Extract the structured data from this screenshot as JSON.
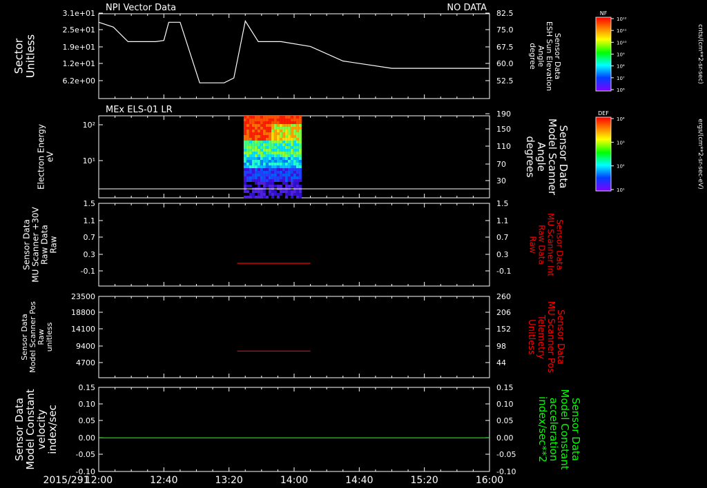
{
  "colors": {
    "background": "#000000",
    "foreground": "#ffffff",
    "red_axis": "#ff0000",
    "green_axis": "#00ff00",
    "spectrogram_hot": "#ff2000",
    "spectrogram_low": "#3010e0"
  },
  "time_axis": {
    "date": "2015/291",
    "ticks": [
      "12:00",
      "12:40",
      "13:20",
      "14:00",
      "14:40",
      "15:20",
      "16:00"
    ],
    "range": [
      "12:00",
      "16:00"
    ]
  },
  "colorbars": [
    {
      "tag": "NF",
      "units": "cnts/(cm**2-sr-sec)",
      "tick_labels": [
        "10¹²",
        "10¹¹",
        "10¹⁰",
        "10⁹",
        "10⁸",
        "10⁷",
        "10⁶"
      ]
    },
    {
      "tag": "DEF",
      "units": "ergs/(cm**2-sr-sec-eV)",
      "tick_labels": [
        "10⁴",
        "10³",
        "10²",
        "10¹"
      ]
    }
  ],
  "chart_data": [
    {
      "type": "line",
      "title": "NPI Vector Data",
      "title_right": "NO DATA",
      "ylabel": [
        "Sector",
        "Unitless"
      ],
      "yticks": [
        "3.1e+01",
        "2.5e+01",
        "1.9e+01",
        "1.2e+01",
        "6.2e+00"
      ],
      "ylabel_right": [
        "Sensor Data",
        "ESH Sun Elevation",
        "Angle",
        "degree"
      ],
      "yticks_right": [
        "82.5",
        "75.0",
        "67.5",
        "60.0",
        "52.5"
      ],
      "ylim_right": [
        47.5,
        82.5
      ],
      "series": [
        {
          "color": "#ffffff",
          "x": [
            "12:00",
            "12:09",
            "12:18",
            "12:35",
            "12:40",
            "12:43",
            "12:50",
            "13:02",
            "13:07",
            "13:12",
            "13:17",
            "13:23",
            "13:30",
            "13:38",
            "13:45",
            "13:52",
            "14:10",
            "14:30",
            "15:00",
            "15:40",
            "16:00"
          ],
          "y": [
            79,
            77,
            71,
            71,
            71.5,
            79,
            79,
            54,
            54,
            54,
            54,
            56,
            79.5,
            71,
            71,
            71,
            69,
            63,
            60,
            60,
            60
          ]
        }
      ]
    },
    {
      "type": "heatmap",
      "title": "MEx ELS-01 LR",
      "ylabel": [
        "Electron Energy",
        "eV"
      ],
      "yscale": "log",
      "yticks": [
        "10²",
        "10¹"
      ],
      "ylabel_right": [
        "Sensor Data",
        "Model Scanner",
        "Angle",
        "degrees"
      ],
      "yticks_right": [
        "190",
        "150",
        "110",
        "70",
        "30"
      ],
      "data_span": [
        "13:29",
        "14:04"
      ],
      "reference_line": "baseline"
    },
    {
      "type": "line",
      "ylabel": [
        "Sensor Data",
        "MU Scanner +30V",
        "Raw Data",
        "Raw"
      ],
      "yticks": [
        "1.5",
        "1.1",
        "0.7",
        "0.3",
        "-0.1"
      ],
      "ylim": [
        -0.5,
        1.5
      ],
      "ylabel_right": [
        "Sensor Data",
        "MU Scanner Int",
        "Raw Data",
        "Raw"
      ],
      "yticks_right": [
        "1.5",
        "1.1",
        "0.7",
        "0.3",
        "-0.1"
      ],
      "series": [
        {
          "color": "#ff0000",
          "x": [
            "13:25",
            "14:10"
          ],
          "y": [
            0.05,
            0.05
          ]
        }
      ]
    },
    {
      "type": "line",
      "ylabel": [
        "Sensor Data",
        "Model Scanner Pos",
        "Raw",
        "unitless"
      ],
      "yticks": [
        "23500",
        "18800",
        "14100",
        "9400",
        "4700"
      ],
      "ylim": [
        0,
        23500
      ],
      "ylabel_right": [
        "Sensor Data",
        "MU Scanner Pos",
        "Telemetry",
        "Unitless"
      ],
      "yticks_right": [
        "260",
        "206",
        "152",
        "98",
        "44"
      ],
      "series": [
        {
          "color": "#ff0000",
          "x": [
            "13:25",
            "14:10"
          ],
          "y": [
            7700,
            7700
          ]
        }
      ]
    },
    {
      "type": "line",
      "ylabel": [
        "Sensor Data",
        "Model Constant",
        "velocity",
        "index/sec"
      ],
      "yticks": [
        "0.15",
        "0.10",
        "0.05",
        "0.00",
        "-0.05",
        "-0.10"
      ],
      "ylim": [
        -0.1,
        0.15
      ],
      "ylabel_right": [
        "Sensor Data",
        "Model Constant",
        "acceleration",
        "index/sec**2"
      ],
      "yticks_right": [
        "0.15",
        "0.10",
        "0.05",
        "0.00",
        "-0.05",
        "-0.10"
      ],
      "series": [
        {
          "color": "#00ff00",
          "x": [
            "12:00",
            "16:00"
          ],
          "y": [
            0.0,
            0.0
          ]
        }
      ]
    }
  ]
}
